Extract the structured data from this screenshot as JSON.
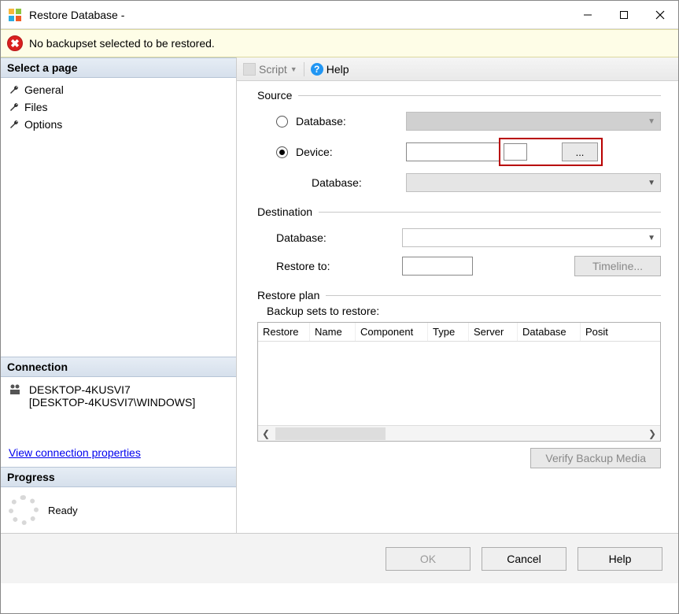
{
  "window": {
    "title": "Restore Database -"
  },
  "warning": {
    "message": "No backupset selected to be restored."
  },
  "left": {
    "select_page": "Select a page",
    "pages": [
      "General",
      "Files",
      "Options"
    ],
    "connection_header": "Connection",
    "connection_line1": "DESKTOP-4KUSVI7",
    "connection_line2": "[DESKTOP-4KUSVI7\\WINDOWS]",
    "view_props_link": "View connection properties",
    "progress_header": "Progress",
    "progress_status": "Ready"
  },
  "toolbar": {
    "script": "Script",
    "help": "Help"
  },
  "source": {
    "title": "Source",
    "database_label": "Database:",
    "device_label": "Device:",
    "browse_label": "...",
    "sub_database_label": "Database:"
  },
  "destination": {
    "title": "Destination",
    "database_label": "Database:",
    "restore_to_label": "Restore to:",
    "timeline_btn": "Timeline..."
  },
  "restore_plan": {
    "title": "Restore plan",
    "backup_sets_label": "Backup sets to restore:",
    "columns": [
      "Restore",
      "Name",
      "Component",
      "Type",
      "Server",
      "Database",
      "Posit"
    ],
    "verify_btn": "Verify Backup Media"
  },
  "buttons": {
    "ok": "OK",
    "cancel": "Cancel",
    "help": "Help"
  }
}
